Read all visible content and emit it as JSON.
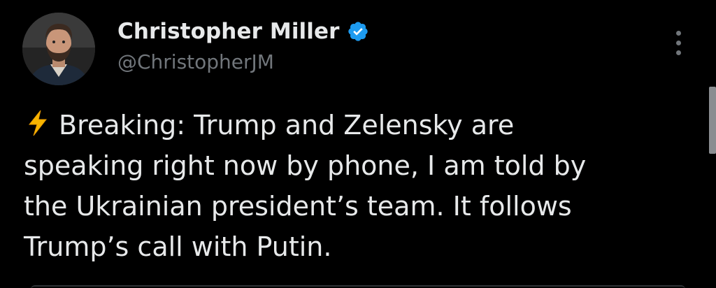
{
  "author": {
    "display_name": "Christopher Miller",
    "handle": "@ChristopherJM",
    "verified": true,
    "verified_icon": "verified-badge-icon",
    "avatar_icon": "profile-photo"
  },
  "tweet": {
    "emoji": "⚡",
    "text": "Breaking: Trump and Zelensky are\nspeaking right now by phone, I am told by\nthe Ukrainian president’s team. It follows\nTrump’s call with Putin."
  },
  "menu": {
    "icon": "more-options-icon"
  },
  "colors": {
    "background": "#000000",
    "primary_text": "#e7e9ea",
    "secondary_text": "#71767b",
    "verified_blue": "#1d9bf0",
    "emoji_yellow": "#f7b500"
  }
}
